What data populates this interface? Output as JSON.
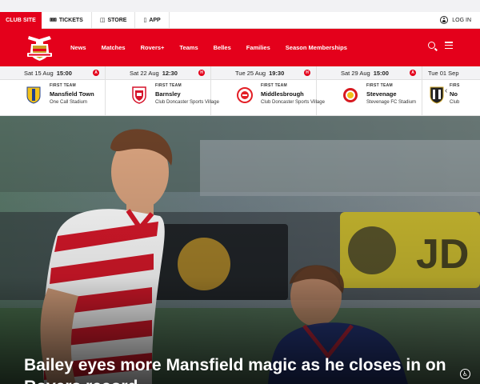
{
  "topbar": {
    "club_site": "CLUB SITE",
    "links": [
      {
        "label": "TICKETS",
        "icon": "ticket-icon"
      },
      {
        "label": "STORE",
        "icon": "bag-icon"
      },
      {
        "label": "APP",
        "icon": "phone-icon"
      }
    ],
    "login": "LOG IN"
  },
  "nav": {
    "items": [
      "News",
      "Matches",
      "Rovers+",
      "Teams",
      "Belles",
      "Families",
      "Season Memberships"
    ]
  },
  "fixtures": [
    {
      "date": "Sat 15 Aug",
      "time": "15:00",
      "venue_type": "A",
      "competition": "FIRST TEAM",
      "opponent": "Mansfield Town",
      "venue": "One Call Stadium",
      "badge_color": "#f2c21a",
      "badge_accent": "#1f3f91"
    },
    {
      "date": "Sat 22 Aug",
      "time": "12:30",
      "venue_type": "H",
      "competition": "FIRST TEAM",
      "opponent": "Barnsley",
      "venue": "Club Doncaster Sports Village",
      "badge_color": "#d6142b",
      "badge_accent": "#ffffff"
    },
    {
      "date": "Tue 25 Aug",
      "time": "19:30",
      "venue_type": "H",
      "competition": "FIRST TEAM",
      "opponent": "Middlesbrough",
      "venue": "Club Doncaster Sports Village",
      "badge_color": "#e31f26",
      "badge_accent": "#ffffff"
    },
    {
      "date": "Sat 29 Aug",
      "time": "15:00",
      "venue_type": "A",
      "competition": "FIRST TEAM",
      "opponent": "Stevenage",
      "venue": "Stevenage FC Stadium",
      "badge_color": "#d71920",
      "badge_accent": "#f2c21a"
    },
    {
      "date": "Tue 01 Sep",
      "time": "",
      "venue_type": "",
      "competition": "FIRS",
      "opponent": "No",
      "venue": "Club",
      "badge_color": "#222222",
      "badge_accent": "#ffffff"
    }
  ],
  "hero": {
    "headline": "Bailey eyes more Mansfield magic as he closes in on Rovers record"
  },
  "colors": {
    "brand_red": "#e4001b"
  }
}
